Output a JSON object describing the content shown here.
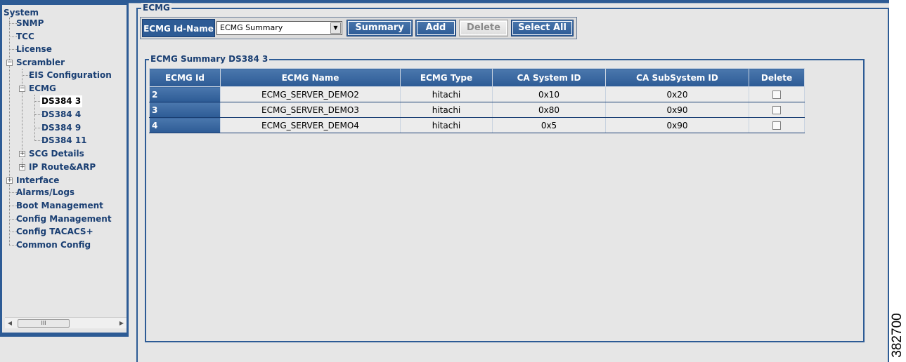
{
  "sidebar": {
    "items": [
      {
        "label": "System"
      },
      {
        "label": "SNMP"
      },
      {
        "label": "TCC"
      },
      {
        "label": "License"
      },
      {
        "label": "Scrambler"
      },
      {
        "label": "EIS Configuration"
      },
      {
        "label": "ECMG"
      },
      {
        "label": "DS384 3"
      },
      {
        "label": "DS384 4"
      },
      {
        "label": "DS384 9"
      },
      {
        "label": "DS384 11"
      },
      {
        "label": "SCG Details"
      },
      {
        "label": "IP Route&ARP"
      },
      {
        "label": "Interface"
      },
      {
        "label": "Alarms/Logs"
      },
      {
        "label": "Boot Management"
      },
      {
        "label": "Config Management"
      },
      {
        "label": "Config TACACS+"
      },
      {
        "label": "Common Config"
      }
    ],
    "selected": "DS384 3",
    "scrollbar_thumb_glyph": "III"
  },
  "main": {
    "frame_title": "ECMG",
    "toolbar": {
      "id_name_label": "ECMG Id-Name",
      "select_value": "ECMG Summary",
      "summary_button": "Summary",
      "add_button": "Add",
      "delete_button": "Delete",
      "select_all_button": "Select All"
    },
    "summary": {
      "title": "ECMG Summary DS384 3",
      "columns": [
        "ECMG Id",
        "ECMG Name",
        "ECMG Type",
        "CA System ID",
        "CA SubSystem ID",
        "Delete"
      ],
      "rows": [
        {
          "id": "2",
          "name": "ECMG_SERVER_DEMO2",
          "type": "hitachi",
          "ca_system_id": "0x10",
          "ca_subsystem_id": "0x20",
          "delete_checked": false
        },
        {
          "id": "3",
          "name": "ECMG_SERVER_DEMO3",
          "type": "hitachi",
          "ca_system_id": "0x80",
          "ca_subsystem_id": "0x90",
          "delete_checked": false
        },
        {
          "id": "4",
          "name": "ECMG_SERVER_DEMO4",
          "type": "hitachi",
          "ca_system_id": "0x5",
          "ca_subsystem_id": "0x90",
          "delete_checked": false
        }
      ]
    }
  },
  "figure_id": "382700",
  "colors": {
    "accent": "#2d5b95",
    "link_text": "#1a3f73",
    "background": "#e6e6e6"
  }
}
